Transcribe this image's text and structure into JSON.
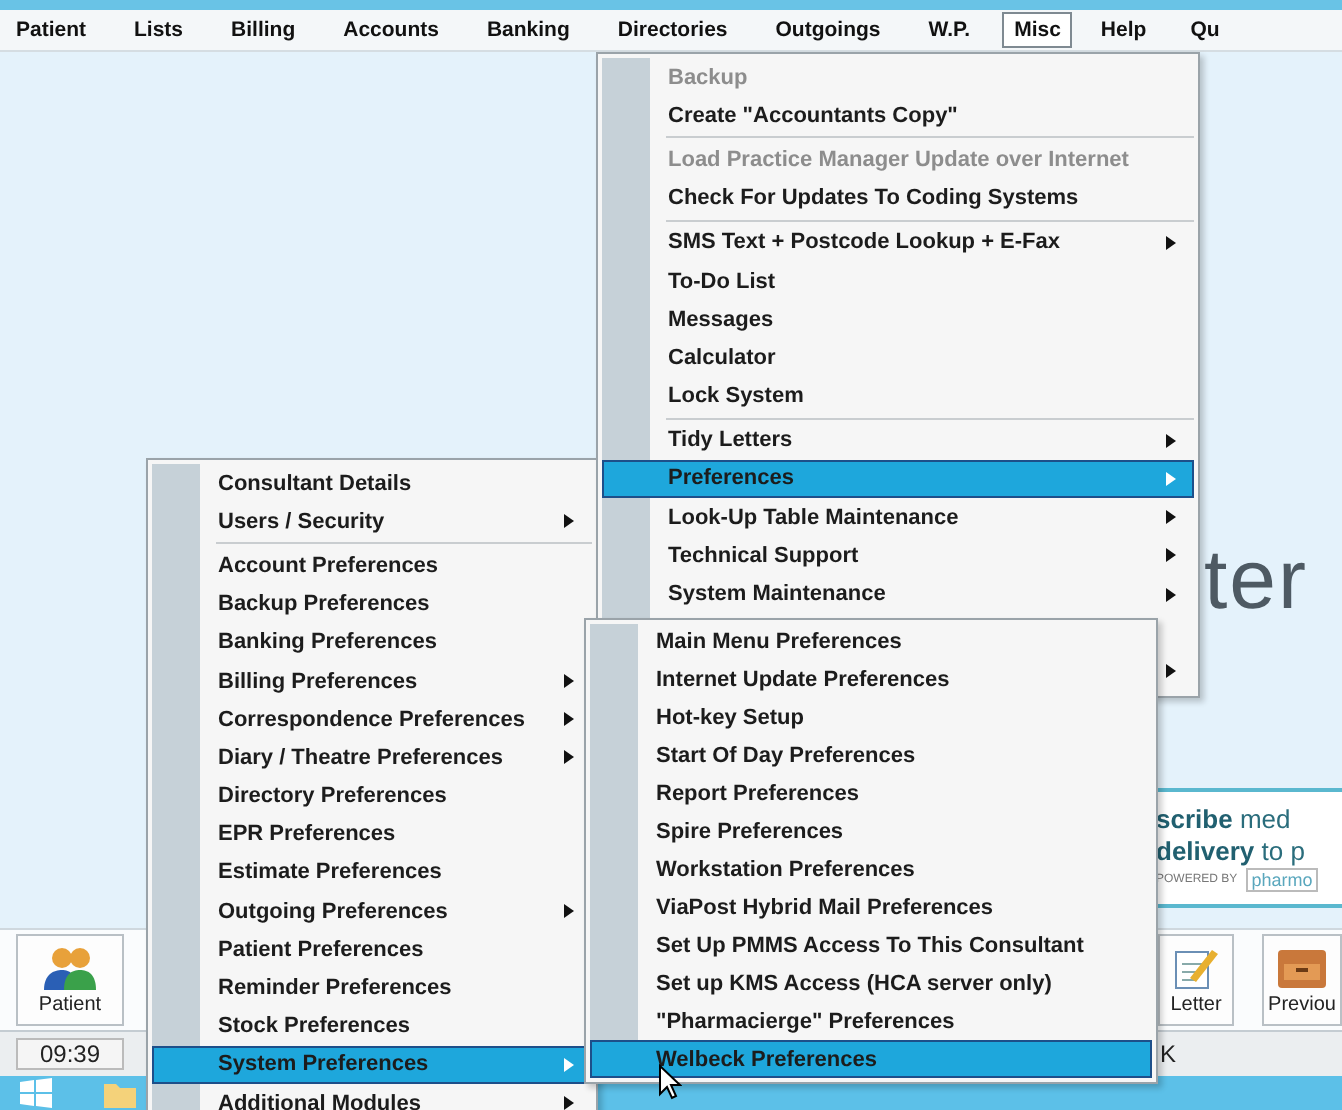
{
  "menubar": [
    {
      "label": "Patient",
      "selected": false
    },
    {
      "label": "Lists",
      "selected": false
    },
    {
      "label": "Billing",
      "selected": false
    },
    {
      "label": "Accounts",
      "selected": false
    },
    {
      "label": "Banking",
      "selected": false
    },
    {
      "label": "Directories",
      "selected": false
    },
    {
      "label": "Outgoings",
      "selected": false
    },
    {
      "label": "W.P.",
      "selected": false
    },
    {
      "label": "Misc",
      "selected": true
    },
    {
      "label": "Help",
      "selected": false
    },
    {
      "label": "Qu",
      "selected": false
    }
  ],
  "background": {
    "logo_text": "ter",
    "banner": {
      "line_1_bold": "scribe",
      "line_1": "med",
      "line_2_bold": "delivery",
      "line_2": "to p",
      "powered_by": "POWERED BY",
      "brand": "pharmo"
    }
  },
  "toolbar": {
    "left": [
      {
        "label": "Patient"
      }
    ],
    "right": [
      {
        "label": "Letter"
      },
      {
        "label": "Previou"
      }
    ]
  },
  "status_bar": {
    "time": "09:39",
    "right_text": "K"
  },
  "misc_menu": [
    {
      "kind": "item",
      "label": "Backup",
      "disabled": true,
      "submenu": false,
      "selected": false
    },
    {
      "kind": "item",
      "label": "Create \"Accountants Copy\"",
      "disabled": false,
      "submenu": false,
      "selected": false
    },
    {
      "kind": "separator"
    },
    {
      "kind": "item",
      "label": "Load Practice Manager Update over Internet",
      "disabled": true,
      "submenu": false,
      "selected": false
    },
    {
      "kind": "item",
      "label": "Check For Updates To Coding Systems",
      "disabled": false,
      "submenu": false,
      "selected": false
    },
    {
      "kind": "separator"
    },
    {
      "kind": "item",
      "label": "SMS Text  + Postcode Lookup + E-Fax",
      "disabled": false,
      "submenu": true,
      "selected": false
    },
    {
      "kind": "item",
      "label": "To-Do List",
      "disabled": false,
      "submenu": false,
      "selected": false
    },
    {
      "kind": "item",
      "label": "Messages",
      "disabled": false,
      "submenu": false,
      "selected": false
    },
    {
      "kind": "item",
      "label": "Calculator",
      "disabled": false,
      "submenu": false,
      "selected": false
    },
    {
      "kind": "item",
      "label": "Lock System",
      "disabled": false,
      "submenu": false,
      "selected": false
    },
    {
      "kind": "separator"
    },
    {
      "kind": "item",
      "label": "Tidy Letters",
      "disabled": false,
      "submenu": true,
      "selected": false
    },
    {
      "kind": "item",
      "label": "Preferences",
      "disabled": false,
      "submenu": true,
      "selected": true
    },
    {
      "kind": "item",
      "label": "Look-Up Table Maintenance",
      "disabled": false,
      "submenu": true,
      "selected": false
    },
    {
      "kind": "item",
      "label": "Technical Support",
      "disabled": false,
      "submenu": true,
      "selected": false
    },
    {
      "kind": "item",
      "label": "System Maintenance",
      "disabled": false,
      "submenu": true,
      "selected": false
    },
    {
      "kind": "covered",
      "submenu": false
    },
    {
      "kind": "covered",
      "submenu": true
    }
  ],
  "preferences_menu": [
    {
      "kind": "item",
      "label": "Consultant Details",
      "submenu": false,
      "selected": false
    },
    {
      "kind": "item",
      "label": "Users / Security",
      "submenu": true,
      "selected": false
    },
    {
      "kind": "separator"
    },
    {
      "kind": "item",
      "label": "Account Preferences",
      "submenu": false,
      "selected": false
    },
    {
      "kind": "item",
      "label": "Backup Preferences",
      "submenu": false,
      "selected": false
    },
    {
      "kind": "item",
      "label": "Banking Preferences",
      "submenu": false,
      "selected": false
    },
    {
      "kind": "item",
      "label": "Billing Preferences",
      "submenu": true,
      "selected": false
    },
    {
      "kind": "item",
      "label": "Correspondence Preferences",
      "submenu": true,
      "selected": false
    },
    {
      "kind": "item",
      "label": "Diary / Theatre Preferences",
      "submenu": true,
      "selected": false
    },
    {
      "kind": "item",
      "label": "Directory Preferences",
      "submenu": false,
      "selected": false
    },
    {
      "kind": "item",
      "label": "EPR Preferences",
      "submenu": false,
      "selected": false
    },
    {
      "kind": "item",
      "label": "Estimate Preferences",
      "submenu": false,
      "selected": false
    },
    {
      "kind": "item",
      "label": "Outgoing Preferences",
      "submenu": true,
      "selected": false
    },
    {
      "kind": "item",
      "label": "Patient Preferences",
      "submenu": false,
      "selected": false
    },
    {
      "kind": "item",
      "label": "Reminder Preferences",
      "submenu": false,
      "selected": false
    },
    {
      "kind": "item",
      "label": "Stock Preferences",
      "submenu": false,
      "selected": false
    },
    {
      "kind": "item",
      "label": "System Preferences",
      "submenu": true,
      "selected": true
    },
    {
      "kind": "item",
      "label": "Additional Modules",
      "submenu": true,
      "selected": false
    }
  ],
  "system_preferences_menu": [
    {
      "kind": "item",
      "label": "Main Menu Preferences",
      "submenu": false,
      "selected": false
    },
    {
      "kind": "item",
      "label": "Internet Update Preferences",
      "submenu": false,
      "selected": false
    },
    {
      "kind": "item",
      "label": "Hot-key Setup",
      "submenu": false,
      "selected": false
    },
    {
      "kind": "item",
      "label": "Start Of Day Preferences",
      "submenu": false,
      "selected": false
    },
    {
      "kind": "item",
      "label": "Report Preferences",
      "submenu": false,
      "selected": false
    },
    {
      "kind": "item",
      "label": "Spire Preferences",
      "submenu": false,
      "selected": false
    },
    {
      "kind": "item",
      "label": "Workstation Preferences",
      "submenu": false,
      "selected": false
    },
    {
      "kind": "item",
      "label": "ViaPost Hybrid Mail Preferences",
      "submenu": false,
      "selected": false
    },
    {
      "kind": "item",
      "label": "Set Up PMMS Access To This Consultant",
      "submenu": false,
      "selected": false
    },
    {
      "kind": "item",
      "label": "Set up KMS Access (HCA server only)",
      "submenu": false,
      "selected": false
    },
    {
      "kind": "item",
      "label": "\"Pharmacierge\" Preferences",
      "submenu": false,
      "selected": false
    },
    {
      "kind": "item",
      "label": "Welbeck Preferences",
      "submenu": false,
      "selected": true
    }
  ]
}
